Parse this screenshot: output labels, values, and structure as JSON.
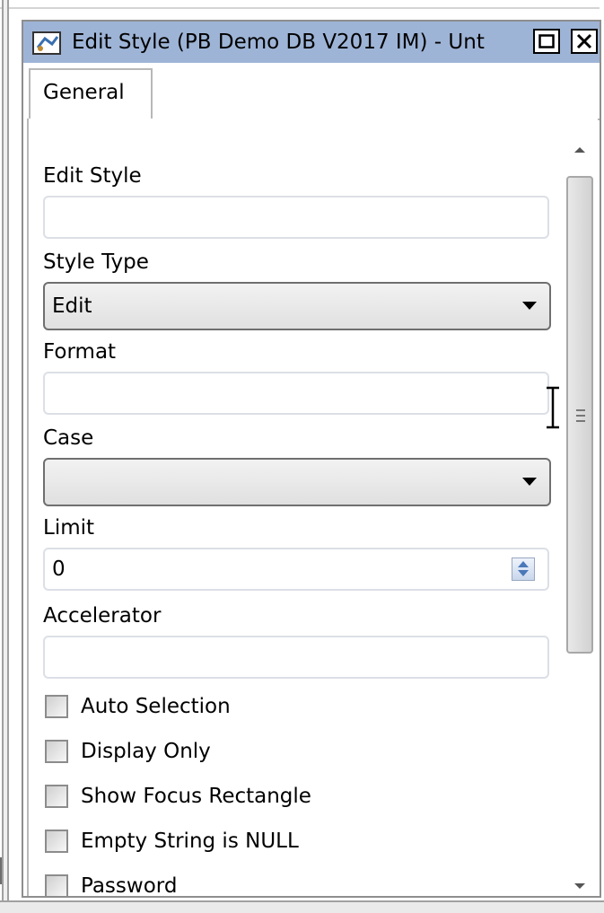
{
  "window": {
    "title": "Edit Style (PB Demo DB V2017 IM) - Unt",
    "maximize_glyph": "□",
    "close_glyph": "✕",
    "app_icon": "painter-app-icon"
  },
  "tabs": [
    {
      "label": "General",
      "active": true
    }
  ],
  "form": {
    "edit_style": {
      "label": "Edit Style",
      "value": ""
    },
    "style_type": {
      "label": "Style Type",
      "value": "Edit"
    },
    "format": {
      "label": "Format",
      "value": ""
    },
    "case": {
      "label": "Case",
      "value": ""
    },
    "limit": {
      "label": "Limit",
      "value": "0"
    },
    "accelerator": {
      "label": "Accelerator",
      "value": ""
    },
    "checkboxes": [
      {
        "label": "Auto Selection",
        "checked": false
      },
      {
        "label": "Display Only",
        "checked": false
      },
      {
        "label": "Show Focus Rectangle",
        "checked": false
      },
      {
        "label": "Empty String is NULL",
        "checked": false
      },
      {
        "label": "Password",
        "checked": false
      }
    ]
  },
  "colors": {
    "titlebar": "#9eb4d6",
    "border": "#8e8e8e",
    "spin_accent": "#4a78b8"
  }
}
